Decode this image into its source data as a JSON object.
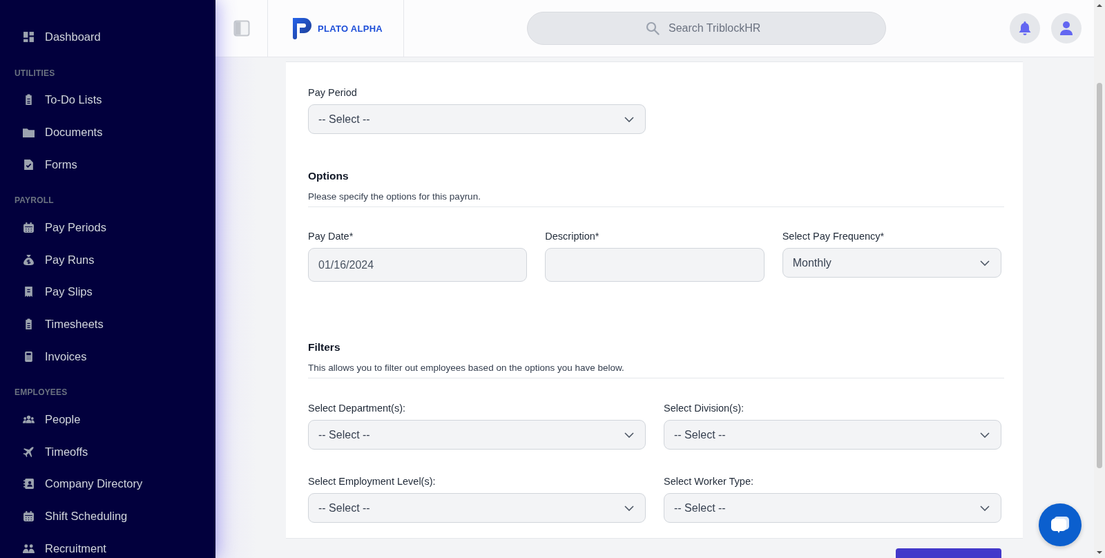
{
  "sidebar": {
    "sections": [
      {
        "items": [
          {
            "label": "Dashboard"
          }
        ]
      },
      {
        "heading": "UTILITIES",
        "items": [
          {
            "label": "To-Do Lists"
          },
          {
            "label": "Documents"
          },
          {
            "label": "Forms"
          }
        ]
      },
      {
        "heading": "PAYROLL",
        "items": [
          {
            "label": "Pay Periods"
          },
          {
            "label": "Pay Runs"
          },
          {
            "label": "Pay Slips"
          },
          {
            "label": "Timesheets"
          },
          {
            "label": "Invoices"
          }
        ]
      },
      {
        "heading": "EMPLOYEES",
        "items": [
          {
            "label": "People"
          },
          {
            "label": "Timeoffs"
          },
          {
            "label": "Company Directory"
          },
          {
            "label": "Shift Scheduling"
          },
          {
            "label": "Recruitment"
          }
        ]
      }
    ]
  },
  "header": {
    "logo_text": "PLATO ALPHA",
    "search": {
      "placeholder": "Search TriblockHR"
    }
  },
  "form": {
    "pay_period": {
      "label": "Pay Period",
      "value": "-- Select --"
    },
    "sections": [
      {
        "title": "Options",
        "description": "Please specify the options for this payrun.",
        "fields": [
          {
            "kind": "input",
            "label": "Pay Date*",
            "value": "01/16/2024"
          },
          {
            "kind": "input",
            "label": "Description*"
          },
          {
            "kind": "select",
            "label": "Select Pay Frequency*",
            "value": "Monthly"
          }
        ]
      },
      {
        "title": "Filters",
        "description": "This allows you to filter out employees based on the options you have below.",
        "fields": [
          {
            "kind": "select",
            "label": "Select Department(s):",
            "value": "-- Select --"
          },
          {
            "kind": "select",
            "label": "Select Division(s):",
            "value": "-- Select --"
          },
          {
            "kind": "select",
            "label": "Select Employment Level(s):",
            "value": "-- Select --"
          },
          {
            "kind": "select",
            "label": "Select Worker Type:",
            "value": "-- Select --"
          }
        ]
      }
    ]
  }
}
